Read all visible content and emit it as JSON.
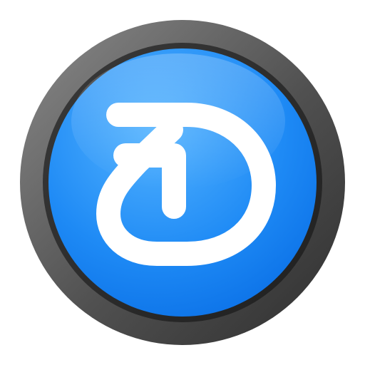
{
  "app_icon": {
    "icon": "d-arrow-logo-icon",
    "colors": {
      "background": "#ffffff",
      "bezel_light": "#8a8a8a",
      "bezel_dark": "#2e2e2e",
      "face_light": "#55b4ff",
      "face_dark": "#0a6fe6",
      "glyph": "#ffffff"
    }
  }
}
